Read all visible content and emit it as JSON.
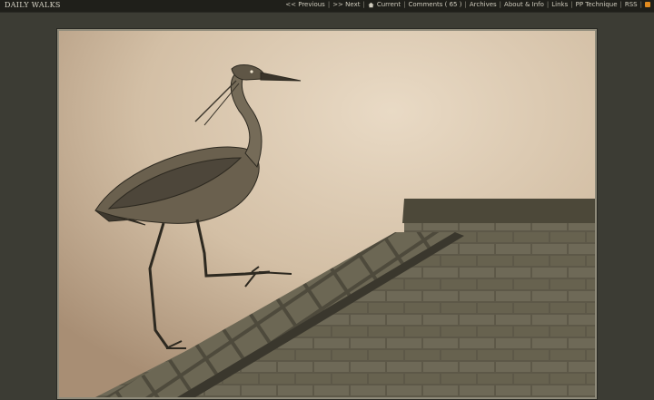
{
  "header": {
    "site_title": "DAILY WALKS",
    "nav": {
      "previous": "<< Previous",
      "next": ">> Next",
      "current": "Current",
      "comments": "Comments ( 65 )",
      "archives": "Archives",
      "about": "About & Info",
      "links": "Links",
      "technique": "PP Technique",
      "rss": "RSS"
    }
  },
  "photo": {
    "subject": "heron",
    "colors": {
      "sky_light": "#e6d6c0",
      "sky_dark": "#b39a80",
      "roof": "#5a5445"
    }
  }
}
